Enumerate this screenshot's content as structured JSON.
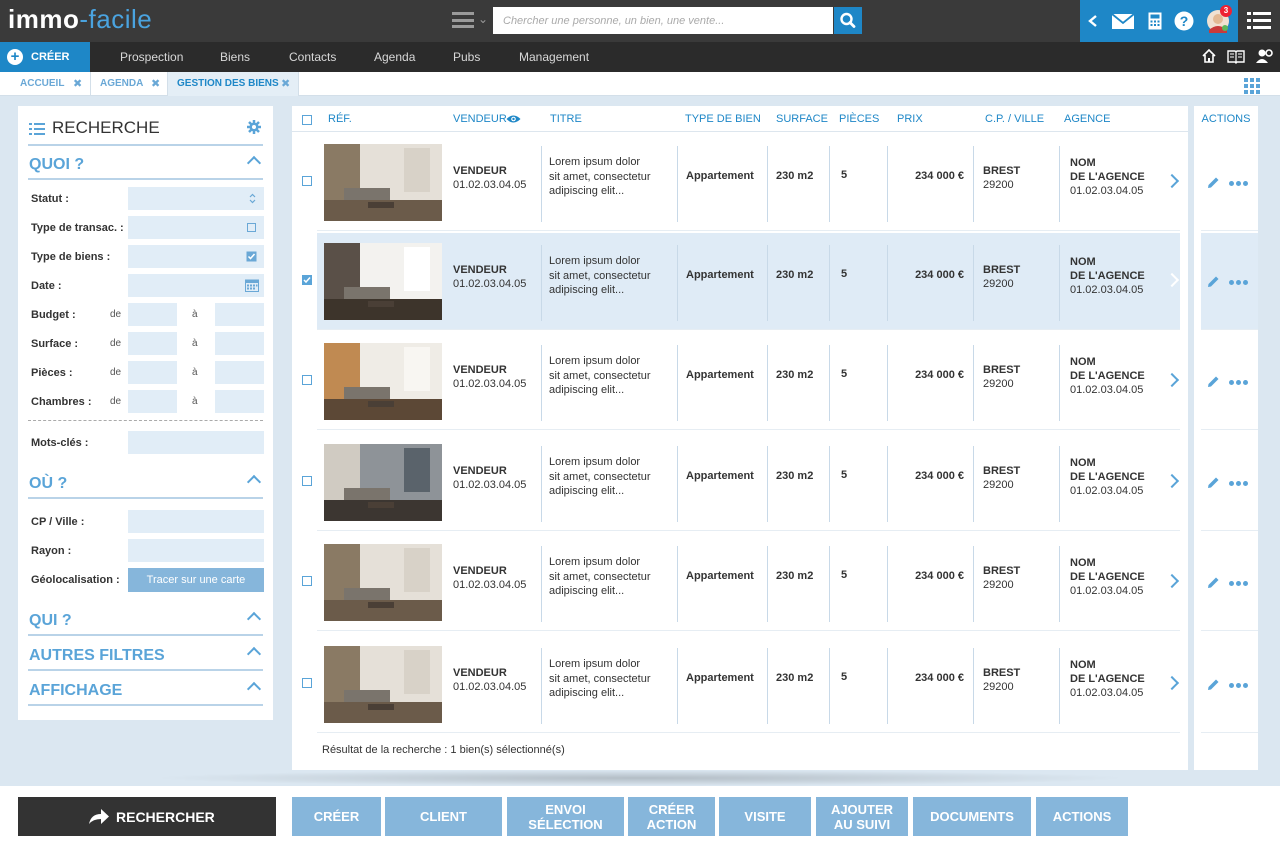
{
  "app": {
    "logo_bold": "immo",
    "logo_dash": "-",
    "logo_light": "facile"
  },
  "topbar": {
    "search_placeholder": "Chercher une personne, un bien, une vente...",
    "notification_count": "3",
    "icons": [
      "menu-icon",
      "search-icon",
      "chevron-left-icon",
      "mail-icon",
      "calculator-icon",
      "help-icon",
      "avatar",
      "list-menu-icon"
    ]
  },
  "nav": {
    "create_label": "CRÉER",
    "items": [
      "Prospection",
      "Biens",
      "Contacts",
      "Agenda",
      "Pubs",
      "Management"
    ]
  },
  "tabs": [
    {
      "label": "ACCUEIL"
    },
    {
      "label": "AGENDA"
    },
    {
      "label": "GESTION DES BIENS"
    }
  ],
  "search_panel": {
    "title": "RECHERCHE",
    "section_quoi": "QUOI ?",
    "fields": {
      "statut": "Statut :",
      "type_transac": "Type de transac. :",
      "type_biens": "Type de biens :",
      "date": "Date :",
      "budget": "Budget :",
      "surface": "Surface :",
      "pieces": "Pièces :",
      "chambres": "Chambres :",
      "mots_cles": "Mots-clés :",
      "cp_ville": "CP / Ville :",
      "rayon": "Rayon :",
      "geoloc": "Géolocalisation :"
    },
    "range_from": "de",
    "range_to": "à",
    "section_ou": "OÙ ?",
    "map_button": "Tracer sur une carte",
    "section_qui": "QUI ?",
    "section_autres": "AUTRES FILTRES",
    "section_affichage": "AFFICHAGE"
  },
  "table": {
    "headers": {
      "ref": "RÉF.",
      "vendeur": "VENDEUR",
      "titre": "TITRE",
      "type": "TYPE DE BIEN",
      "surface": "SURFACE",
      "pieces": "PIÈCES",
      "prix": "PRIX",
      "cp_ville": "C.P. / VILLE",
      "agence": "AGENCE"
    },
    "rows": [
      {
        "vendeur": "VENDEUR",
        "tel": "01.02.03.04.05",
        "titre1": "Lorem ipsum dolor",
        "titre2": "sit amet, consectetur",
        "titre3": "adipiscing elit...",
        "type": "Appartement",
        "surface": "230 m2",
        "pieces": "5",
        "prix": "234 000 €",
        "ville": "BREST",
        "cp": "29200",
        "agence1": "NOM",
        "agence2": "DE L'AGENCE",
        "agence_tel": "01.02.03.04.05",
        "checked": false
      },
      {
        "vendeur": "VENDEUR",
        "tel": "01.02.03.04.05",
        "titre1": "Lorem ipsum dolor",
        "titre2": "sit amet, consectetur",
        "titre3": "adipiscing elit...",
        "type": "Appartement",
        "surface": "230 m2",
        "pieces": "5",
        "prix": "234 000 €",
        "ville": "BREST",
        "cp": "29200",
        "agence1": "NOM",
        "agence2": "DE L'AGENCE",
        "agence_tel": "01.02.03.04.05",
        "checked": true
      },
      {
        "vendeur": "VENDEUR",
        "tel": "01.02.03.04.05",
        "titre1": "Lorem ipsum dolor",
        "titre2": "sit amet, consectetur",
        "titre3": "adipiscing elit...",
        "type": "Appartement",
        "surface": "230 m2",
        "pieces": "5",
        "prix": "234 000 €",
        "ville": "BREST",
        "cp": "29200",
        "agence1": "NOM",
        "agence2": "DE L'AGENCE",
        "agence_tel": "01.02.03.04.05",
        "checked": false
      },
      {
        "vendeur": "VENDEUR",
        "tel": "01.02.03.04.05",
        "titre1": "Lorem ipsum dolor",
        "titre2": "sit amet, consectetur",
        "titre3": "adipiscing elit...",
        "type": "Appartement",
        "surface": "230 m2",
        "pieces": "5",
        "prix": "234 000 €",
        "ville": "BREST",
        "cp": "29200",
        "agence1": "NOM",
        "agence2": "DE L'AGENCE",
        "agence_tel": "01.02.03.04.05",
        "checked": false
      },
      {
        "vendeur": "VENDEUR",
        "tel": "01.02.03.04.05",
        "titre1": "Lorem ipsum dolor",
        "titre2": "sit amet, consectetur",
        "titre3": "adipiscing elit...",
        "type": "Appartement",
        "surface": "230 m2",
        "pieces": "5",
        "prix": "234 000 €",
        "ville": "BREST",
        "cp": "29200",
        "agence1": "NOM",
        "agence2": "DE L'AGENCE",
        "agence_tel": "01.02.03.04.05",
        "checked": false
      },
      {
        "vendeur": "VENDEUR",
        "tel": "01.02.03.04.05",
        "titre1": "Lorem ipsum dolor",
        "titre2": "sit amet, consectetur",
        "titre3": "adipiscing elit...",
        "type": "Appartement",
        "surface": "230 m2",
        "pieces": "5",
        "prix": "234 000 €",
        "ville": "BREST",
        "cp": "29200",
        "agence1": "NOM",
        "agence2": "DE L'AGENCE",
        "agence_tel": "01.02.03.04.05",
        "checked": false
      }
    ],
    "result_text": "Résultat de la recherche : 1 bien(s) sélectionné(s)"
  },
  "actions_panel": {
    "header": "ACTIONS"
  },
  "bottom": {
    "search_button": "RECHERCHER",
    "buttons": [
      {
        "line1": "CRÉER",
        "line2": ""
      },
      {
        "line1": "CLIENT",
        "line2": ""
      },
      {
        "line1": "ENVOI",
        "line2": "SÉLECTION"
      },
      {
        "line1": "CRÉER",
        "line2": "ACTION"
      },
      {
        "line1": "VISITE",
        "line2": ""
      },
      {
        "line1": "AJOUTER",
        "line2": "AU SUIVI"
      },
      {
        "line1": "DOCUMENTS",
        "line2": ""
      },
      {
        "line1": "ACTIONS",
        "line2": ""
      }
    ]
  },
  "colors": {
    "brand_blue": "#1e87c7",
    "light_blue": "#86b6db",
    "dark": "#333333",
    "selected_row": "#dfebf6"
  }
}
